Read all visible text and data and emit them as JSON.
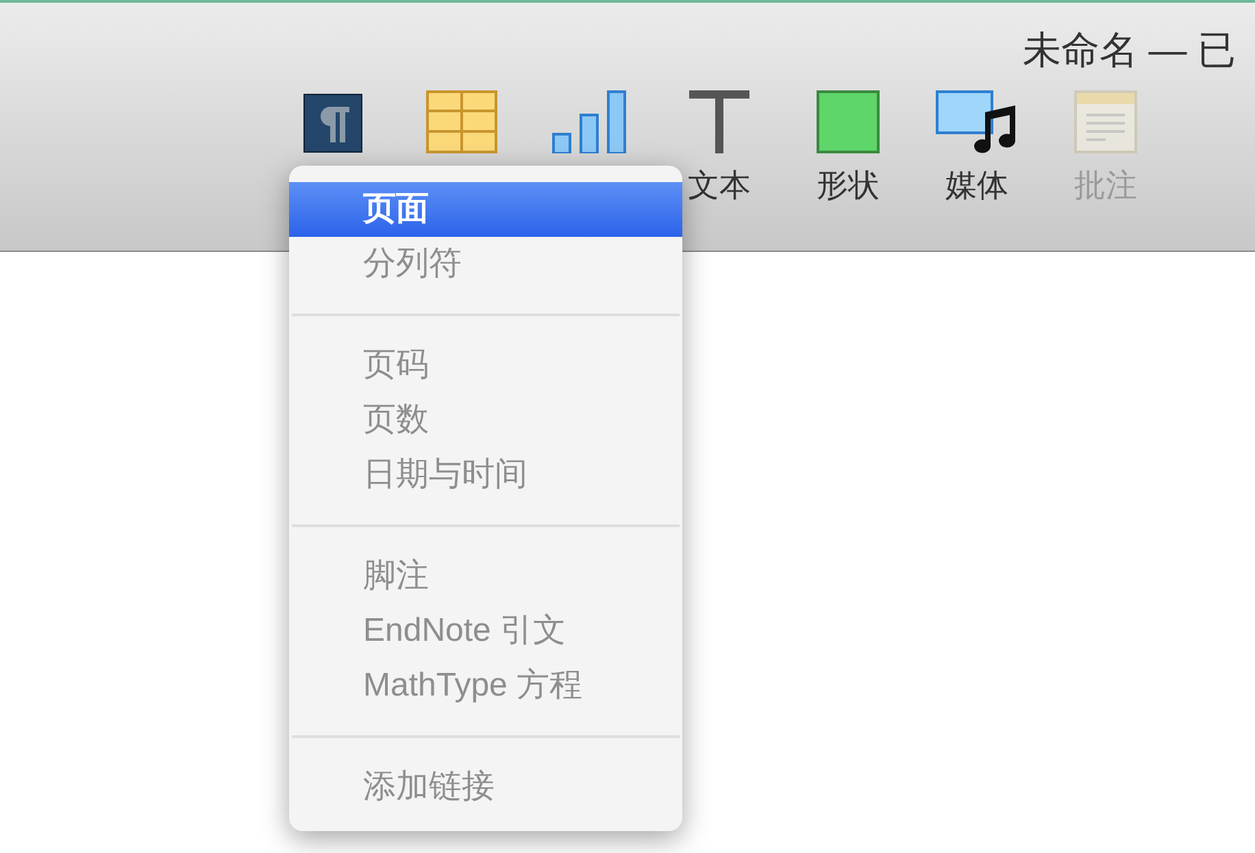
{
  "window": {
    "title": "未命名 — 已"
  },
  "toolbar": [
    {
      "kind": "text-style"
    },
    {
      "kind": "table"
    },
    {
      "kind": "chart"
    },
    {
      "kind": "text",
      "label": "文本",
      "disabled": false
    },
    {
      "kind": "shape",
      "label": "形状",
      "disabled": false
    },
    {
      "kind": "media",
      "label": "媒体",
      "disabled": false
    },
    {
      "kind": "comment",
      "label": "批注",
      "disabled": true
    }
  ],
  "menu": {
    "sections": [
      [
        {
          "label": "页面",
          "selected": true,
          "disabled": false
        },
        {
          "label": "分列符",
          "selected": false,
          "disabled": true
        }
      ],
      [
        {
          "label": "页码",
          "selected": false,
          "disabled": true
        },
        {
          "label": "页数",
          "selected": false,
          "disabled": true
        },
        {
          "label": "日期与时间",
          "selected": false,
          "disabled": true
        }
      ],
      [
        {
          "label": "脚注",
          "selected": false,
          "disabled": true
        },
        {
          "label": "EndNote 引文",
          "selected": false,
          "disabled": true
        },
        {
          "label": "MathType 方程",
          "selected": false,
          "disabled": true
        }
      ],
      [
        {
          "label": "添加链接",
          "selected": false,
          "disabled": true
        }
      ]
    ]
  }
}
